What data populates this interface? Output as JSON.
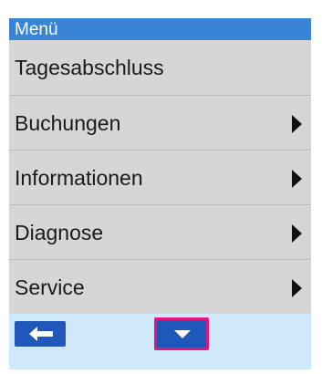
{
  "header": {
    "title": "Menü"
  },
  "menu": {
    "items": [
      {
        "label": "Tagesabschluss",
        "has_submenu": false
      },
      {
        "label": "Buchungen",
        "has_submenu": true
      },
      {
        "label": "Informationen",
        "has_submenu": true
      },
      {
        "label": "Diagnose",
        "has_submenu": true
      },
      {
        "label": "Service",
        "has_submenu": true
      }
    ]
  },
  "footer": {
    "back_icon": "arrow-left-icon",
    "down_icon": "triangle-down-icon"
  },
  "colors": {
    "header_bg": "#3a84d6",
    "menu_bg": "#d6d6d6",
    "footer_bg": "#cfe9fb",
    "button_bg": "#1f58ba",
    "highlight": "#e6157e"
  }
}
